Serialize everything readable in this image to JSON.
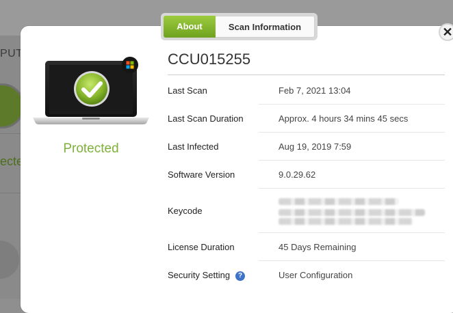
{
  "background": {
    "partial_text_1": "PUTE",
    "partial_text_2": "ecte"
  },
  "tabs": [
    {
      "label": "About",
      "active": true
    },
    {
      "label": "Scan Information",
      "active": false
    }
  ],
  "close_label": "✕",
  "device": {
    "name": "CCU015255",
    "status": "Protected",
    "status_color": "#7fb03a",
    "os_badge_icon": "windows-logo-icon"
  },
  "details": [
    {
      "label": "Last Scan",
      "value": "Feb 7, 2021 13:04"
    },
    {
      "label": "Last Scan Duration",
      "value": "Approx. 4 hours 34 mins 45 secs"
    },
    {
      "label": "Last Infected",
      "value": "Aug 19, 2019 7:59"
    },
    {
      "label": "Software Version",
      "value": "9.0.29.62"
    },
    {
      "label": "Keycode",
      "value": ""
    },
    {
      "label": "License Duration",
      "value": "45 Days Remaining"
    },
    {
      "label": "Security Setting",
      "value": "User Configuration",
      "help_icon": "?"
    }
  ],
  "colors": {
    "accent_green": "#7fb03a",
    "help_blue": "#3f72c9"
  }
}
